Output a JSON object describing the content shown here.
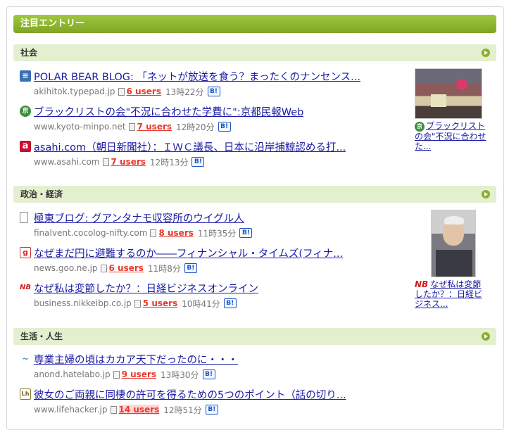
{
  "header": {
    "title": "注目エントリー"
  },
  "sections": [
    {
      "name": "社会",
      "entries": [
        {
          "title": "POLAR BEAR BLOG: 「ネットが放送を食う？まったくのナンセンス...",
          "domain": "akihitok.typepad.jp",
          "users": "6 users",
          "time": "13時22分",
          "bookmark": "B!"
        },
        {
          "title": "ブラックリストの会\"不況に合わせた学費に\":京都民報Web",
          "domain": "www.kyoto-minpo.net",
          "users": "7 users",
          "time": "12時20分",
          "bookmark": "B!"
        },
        {
          "title": "asahi.com（朝日新聞社）：ＩＷＣ議長、日本に沿岸捕鯨認める打...",
          "domain": "www.asahi.com",
          "users": "7 users",
          "time": "12時13分",
          "bookmark": "B!"
        }
      ],
      "thumb_caption": "ブラックリストの会\"不況に合わせた...",
      "thumb_icon": "京"
    },
    {
      "name": "政治・経済",
      "entries": [
        {
          "title": "極東ブログ: グアンタナモ収容所のウイグル人",
          "domain": "finalvent.cocolog-nifty.com",
          "users": "8 users",
          "time": "11時35分",
          "bookmark": "B!"
        },
        {
          "title": "なぜまだ円に避難するのか――フィナンシャル・タイムズ(フィナ...",
          "domain": "news.goo.ne.jp",
          "users": "6 users",
          "time": "11時8分",
          "bookmark": "B!"
        },
        {
          "title": "なぜ私は変節したか？：日経ビジネスオンライン",
          "domain": "business.nikkeibp.co.jp",
          "users": "5 users",
          "time": "10時41分",
          "bookmark": "B!"
        }
      ],
      "thumb_caption": "なぜ私は変節したか？：日経ビジネス...",
      "thumb_icon": "NB"
    },
    {
      "name": "生活・人生",
      "entries": [
        {
          "title": "専業主婦の頃はカカア天下だったのに・・・",
          "domain": "anond.hatelabo.jp",
          "users": "9 users",
          "time": "13時30分",
          "bookmark": "B!"
        },
        {
          "title": "彼女のご両親に同棲の許可を得るための5つのポイント（話の切り...",
          "domain": "www.lifehacker.jp",
          "users": "14 users",
          "time": "12時51分",
          "bookmark": "B!"
        }
      ]
    }
  ],
  "favicons": {
    "s0e0": "≡",
    "s0e1": "京",
    "s0e2": "a",
    "s1e0": "",
    "s1e1": "g",
    "s1e2": "NB",
    "s2e0": "~",
    "s2e1": "Lh"
  },
  "colors": {
    "accent": "#8aaf2a",
    "link": "#1a1aa6",
    "users": "#e8382e"
  }
}
